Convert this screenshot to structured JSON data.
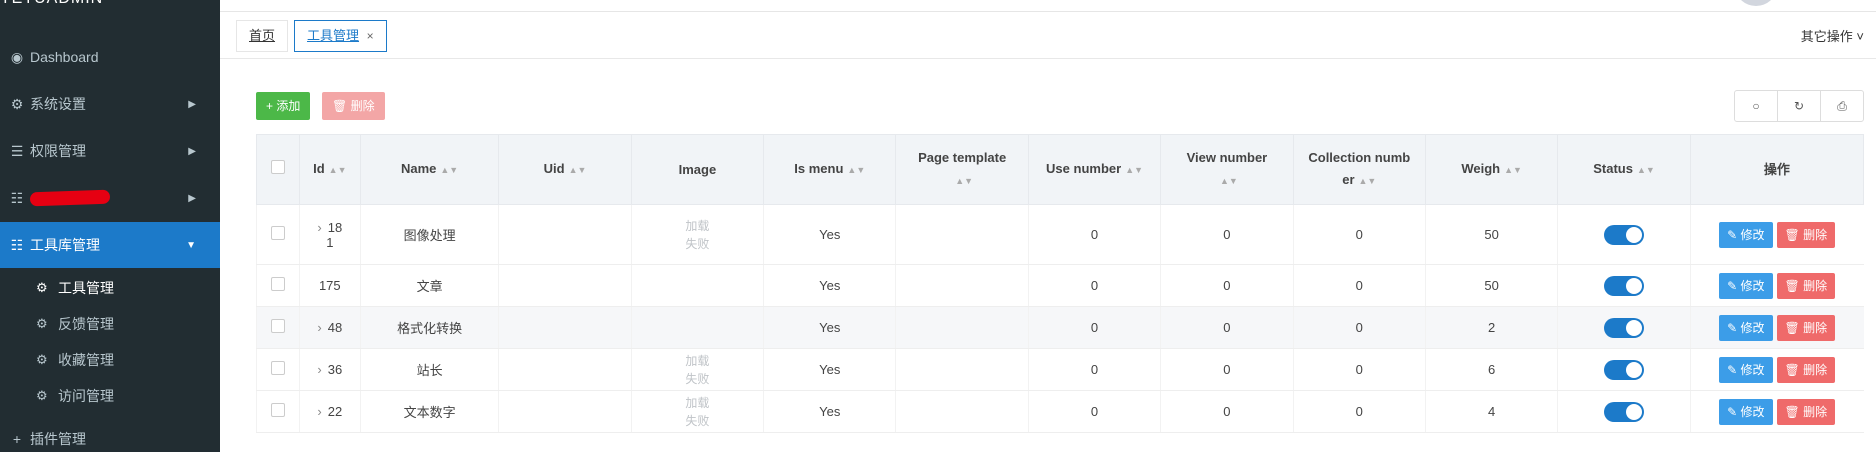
{
  "brand": "YETUADMIN",
  "sidebar": {
    "items": [
      {
        "icon": "dashboard-icon",
        "glyph": "◉",
        "label": "Dashboard"
      },
      {
        "icon": "gear-icon",
        "glyph": "⚙",
        "label": "系统设置"
      },
      {
        "icon": "list-icon",
        "glyph": "☰",
        "label": "权限管理"
      },
      {
        "icon": "list-icon",
        "glyph": "☷",
        "label": ""
      },
      {
        "icon": "list-icon",
        "glyph": "☷",
        "label": "工具库管理"
      }
    ],
    "sub_items": [
      {
        "icon": "cogs-icon",
        "glyph": "⚙",
        "label": "工具管理"
      },
      {
        "icon": "cogs-icon",
        "glyph": "⚙",
        "label": "反馈管理"
      },
      {
        "icon": "cogs-icon",
        "glyph": "⚙",
        "label": "收藏管理"
      },
      {
        "icon": "cogs-icon",
        "glyph": "⚙",
        "label": "访问管理"
      }
    ],
    "bottom_item": {
      "icon": "plus-icon",
      "glyph": "+",
      "label": "插件管理"
    }
  },
  "tabs": [
    {
      "label": "首页"
    },
    {
      "label": "工具管理",
      "close": "×"
    }
  ],
  "other_ops": "其它操作 ˅",
  "toolbar": {
    "add_label": "+ 添加",
    "delete_label": "🗑 删除"
  },
  "tool_icons": {
    "search": "○",
    "refresh": "↻",
    "print": "⎙"
  },
  "table": {
    "headers": {
      "id": "Id",
      "name": "Name",
      "uid": "Uid",
      "image": "Image",
      "is_menu": "Is menu",
      "page_template": "Page template",
      "use_number": "Use number",
      "view_number": "View number",
      "collection_number_a": "Collection numb",
      "collection_number_b": "er",
      "weigh": "Weigh",
      "status": "Status",
      "ops": "操作"
    },
    "image_placeholder_a": "加载",
    "image_placeholder_b": "失败",
    "edit_label": "✎ 修改",
    "del_label": "🗑 删除",
    "rows": [
      {
        "id_a": "18",
        "id_b": "1",
        "name": "图像处理",
        "is_menu": "Yes",
        "use": "0",
        "view": "0",
        "collect": "0",
        "weigh": "50"
      },
      {
        "id": "175",
        "name": "文章",
        "is_menu": "Yes",
        "use": "0",
        "view": "0",
        "collect": "0",
        "weigh": "50"
      },
      {
        "id": "48",
        "name": "格式化转换",
        "is_menu": "Yes",
        "use": "0",
        "view": "0",
        "collect": "0",
        "weigh": "2"
      },
      {
        "id": "36",
        "name": "站长",
        "is_menu": "Yes",
        "use": "0",
        "view": "0",
        "collect": "0",
        "weigh": "6"
      },
      {
        "id": "22",
        "name": "文本数字",
        "is_menu": "Yes",
        "use": "0",
        "view": "0",
        "collect": "0",
        "weigh": "4"
      }
    ]
  }
}
